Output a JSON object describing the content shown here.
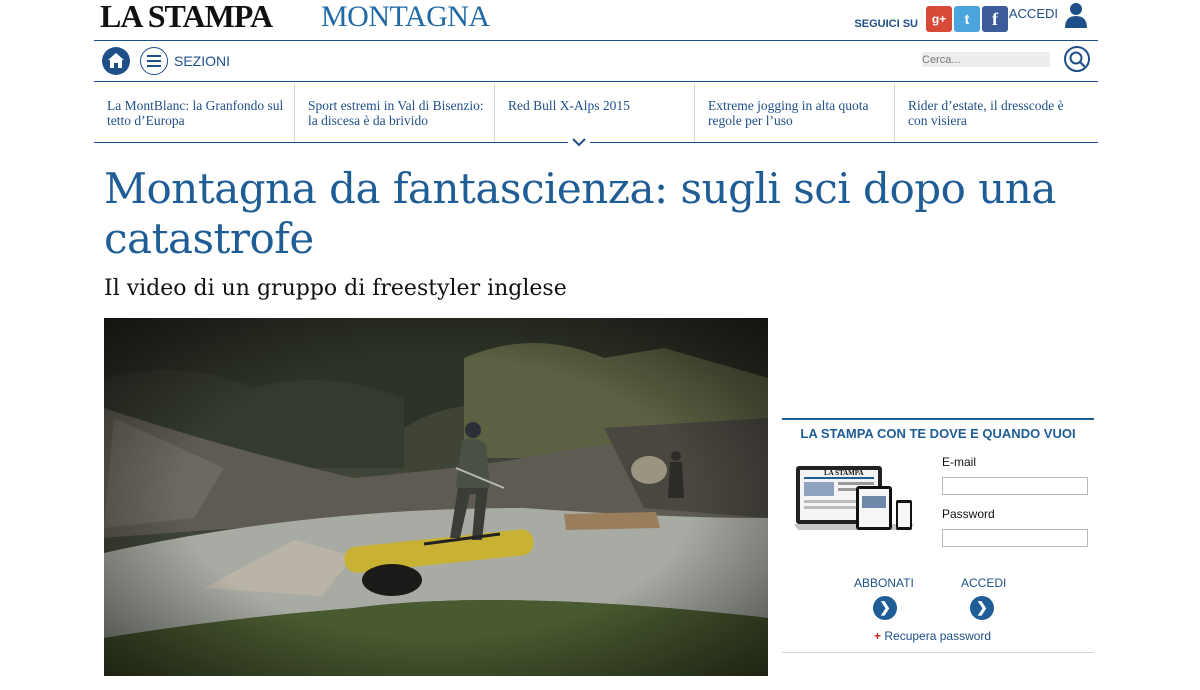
{
  "masthead": {
    "brand": "LA STAMPA",
    "section": "MONTAGNA",
    "follow_label": "SEGUICI SU",
    "social": [
      {
        "name": "gplus-icon",
        "glyph": "g+"
      },
      {
        "name": "twitter-icon",
        "glyph": "t"
      },
      {
        "name": "facebook-icon",
        "glyph": "f"
      }
    ],
    "login_label": "ACCEDI"
  },
  "navbar": {
    "sections_label": "SEZIONI",
    "search_placeholder": "Cerca..."
  },
  "related": [
    {
      "title": "La MontBlanc: la Granfondo sul tetto d’Europa"
    },
    {
      "title": "Sport estremi in Val di Bisenzio: la discesa è da brivido"
    },
    {
      "title": "Red Bull X-Alps 2015"
    },
    {
      "title": "Extreme jogging in alta quota regole per l’uso"
    },
    {
      "title": "Rider d’estate, il dresscode è con visiera"
    }
  ],
  "article": {
    "headline": "Montagna da fantascienza: sugli sci dopo una catastrofe",
    "subheadline": "Il video di un gruppo di freestyler inglese"
  },
  "login_box": {
    "title": "LA STAMPA CON TE DOVE E QUANDO VUOI",
    "device_logo": "LA STAMPA",
    "email_label": "E-mail",
    "password_label": "Password",
    "subscribe_label": "ABBONATI",
    "login_label": "ACCEDI",
    "recover_label": "Recupera password",
    "recover_prefix": "+"
  },
  "colors": {
    "brand_blue": "#1f5d96",
    "nav_blue": "#1f4f88",
    "gplus": "#d84a38",
    "twitter": "#4aa5dd",
    "facebook": "#3b5b99"
  }
}
